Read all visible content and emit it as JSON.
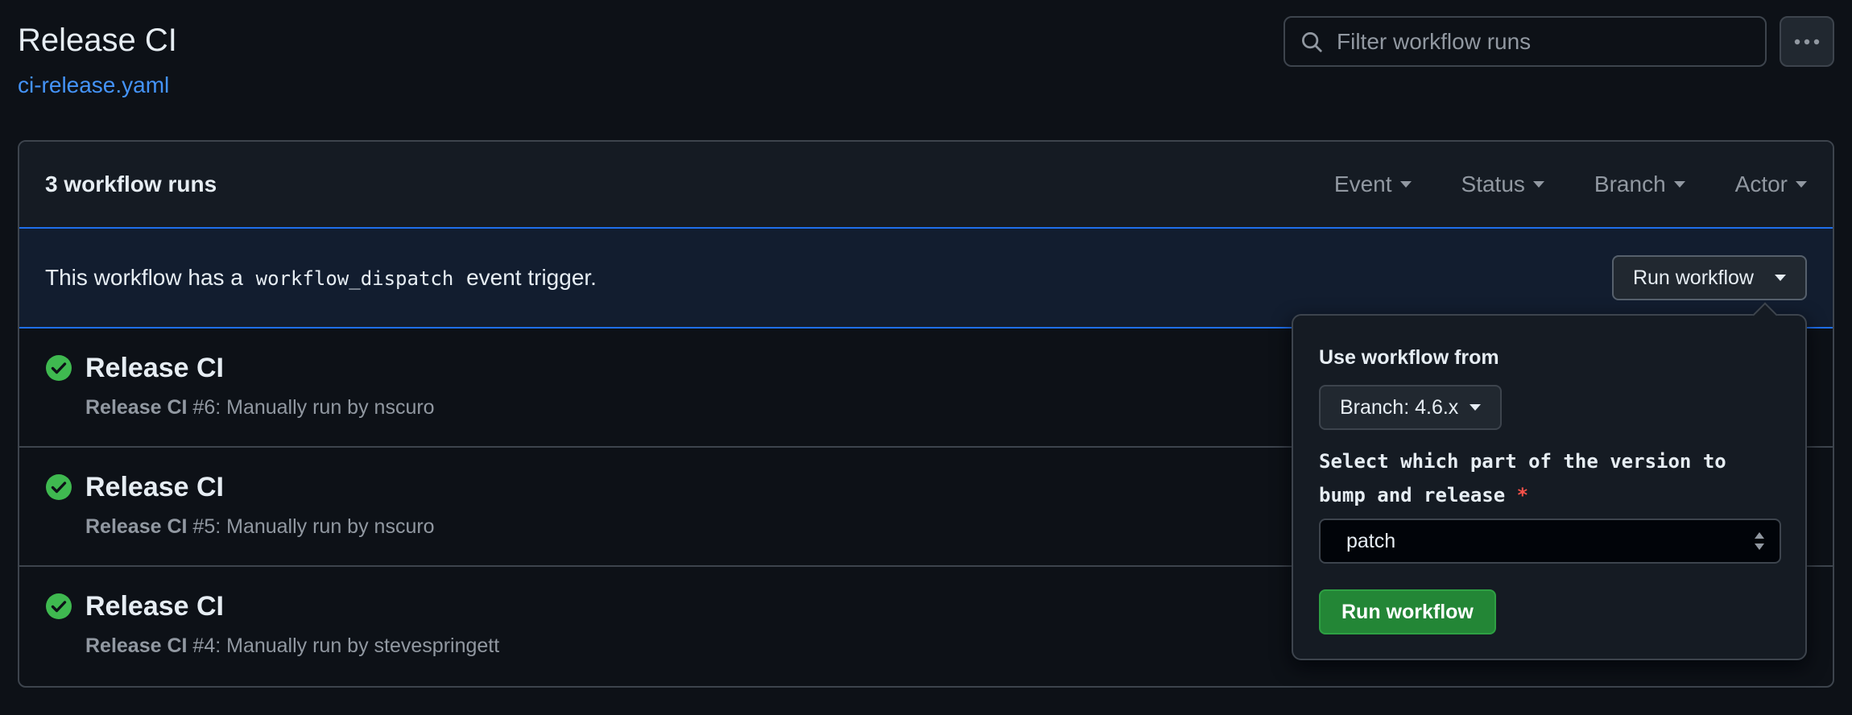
{
  "header": {
    "title": "Release CI",
    "file_link": "ci-release.yaml",
    "search_placeholder": "Filter workflow runs"
  },
  "runs_box": {
    "count_label": "3 workflow runs",
    "filters": [
      "Event",
      "Status",
      "Branch",
      "Actor"
    ]
  },
  "dispatch": {
    "text_before": "This workflow has a",
    "code": "workflow_dispatch",
    "text_after": "event trigger.",
    "button_label": "Run workflow"
  },
  "runs": [
    {
      "title": "Release CI",
      "workflow": "Release CI",
      "detail": " #6: Manually run by nscuro",
      "status": "success"
    },
    {
      "title": "Release CI",
      "workflow": "Release CI",
      "detail": " #5: Manually run by nscuro",
      "status": "success"
    },
    {
      "title": "Release CI",
      "workflow": "Release CI",
      "detail": " #4: Manually run by stevespringett",
      "status": "success"
    }
  ],
  "popover": {
    "use_label": "Use workflow from",
    "branch_label": "Branch: 4.6.x",
    "input_label": "Select which part of the version to bump and release",
    "required_mark": "*",
    "selected_value": "patch",
    "submit_label": "Run workflow"
  },
  "colors": {
    "background": "#0d1117",
    "accent_blue": "#4493f8",
    "success_green": "#3fb950",
    "primary_button": "#238636",
    "required_red": "#f85149"
  },
  "icons": [
    "search-icon",
    "kebab-menu-icon",
    "check-circle-icon",
    "select-arrows-icon"
  ]
}
